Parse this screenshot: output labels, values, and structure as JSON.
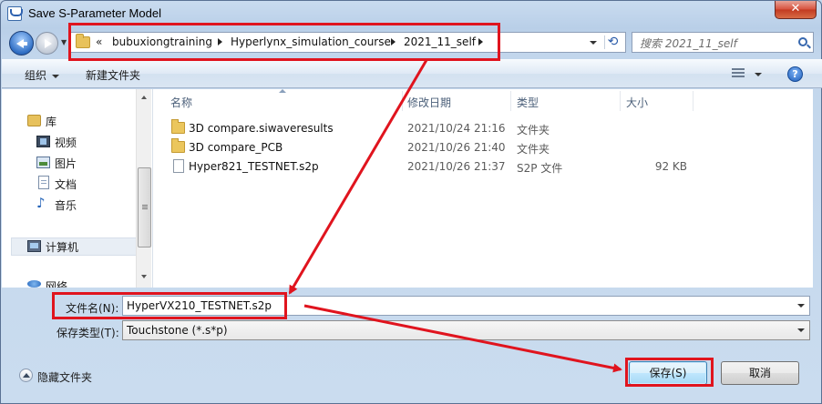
{
  "window": {
    "title": "Save S-Parameter Model",
    "close_symbol": "✕"
  },
  "address": {
    "chevron": "«",
    "crumbs": [
      "bubuxiongtraining",
      "Hyperlynx_simulation_course",
      "2021_11_self"
    ],
    "search_placeholder": "搜索 2021_11_self"
  },
  "toolbar": {
    "organize_label": "组织",
    "new_folder_label": "新建文件夹",
    "help_symbol": "?"
  },
  "sidebar": {
    "items": [
      {
        "label": "库",
        "icon": "library-icon"
      },
      {
        "label": "视频",
        "icon": "video-icon"
      },
      {
        "label": "图片",
        "icon": "pictures-icon"
      },
      {
        "label": "文档",
        "icon": "documents-icon"
      },
      {
        "label": "音乐",
        "icon": "music-icon"
      },
      {
        "label": "计算机",
        "icon": "computer-icon"
      },
      {
        "label": "网络",
        "icon": "network-icon"
      }
    ]
  },
  "columns": {
    "name": "名称",
    "date": "修改日期",
    "type": "类型",
    "size": "大小"
  },
  "files": [
    {
      "name": "3D compare.siwaveresults",
      "date": "2021/10/24 21:16",
      "type": "文件夹",
      "size": "",
      "icon": "folder-icon"
    },
    {
      "name": "3D compare_PCB",
      "date": "2021/10/26 21:40",
      "type": "文件夹",
      "size": "",
      "icon": "folder-icon"
    },
    {
      "name": "Hyper821_TESTNET.s2p",
      "date": "2021/10/26 21:37",
      "type": "S2P 文件",
      "size": "92 KB",
      "icon": "file-icon"
    }
  ],
  "form": {
    "filename_label": "文件名(N):",
    "filename_value": "HyperVX210_TESTNET.s2p",
    "filetype_label": "保存类型(T):",
    "filetype_value": "Touchstone (*.s*p)"
  },
  "footer": {
    "hide_folders_label": "隐藏文件夹",
    "save_label": "保存(S)",
    "cancel_label": "取消"
  },
  "annotation": {
    "highlight_color": "#e0141e"
  }
}
